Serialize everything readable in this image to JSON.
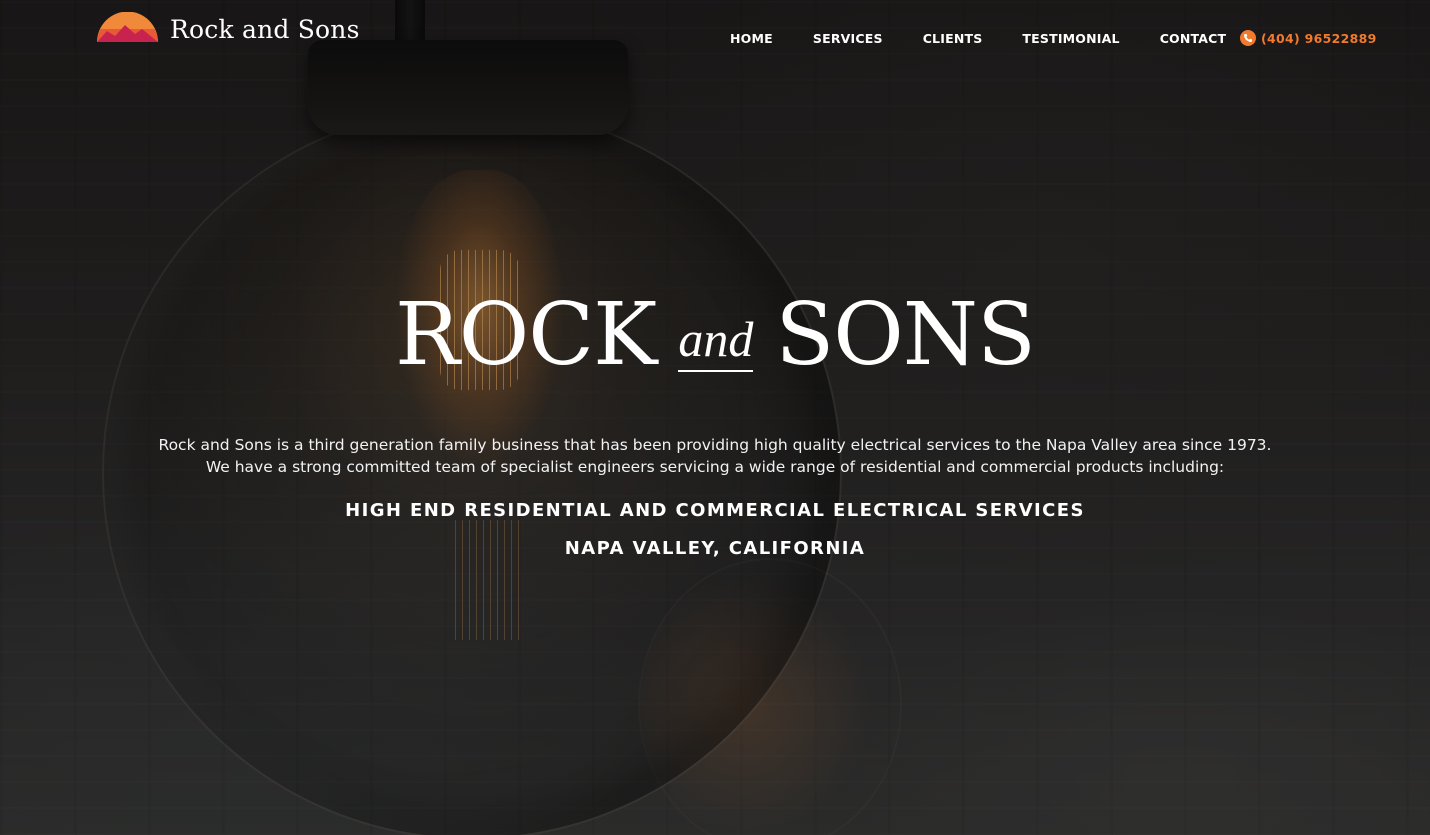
{
  "brand": {
    "name": "Rock and Sons",
    "logo_colors": [
      "#f08a3a",
      "#e2463f",
      "#c8234f"
    ]
  },
  "nav": {
    "items": [
      {
        "label": "HOME"
      },
      {
        "label": "SERVICES"
      },
      {
        "label": "CLIENTS"
      },
      {
        "label": "TESTIMONIAL"
      },
      {
        "label": "CONTACT"
      }
    ],
    "phone": {
      "icon": "phone-icon",
      "number": "(404) 96522889",
      "color": "#f07a2e"
    }
  },
  "hero": {
    "title_left": "ROCK",
    "title_connector": "and",
    "title_right": "SONS",
    "description": [
      "Rock and Sons is a third generation family business that has been providing high quality electrical services to the Napa Valley area since 1973.",
      "We have a strong committed team of specialist engineers servicing a wide range of residential and commercial products including:"
    ],
    "tagline": "HIGH END RESIDENTIAL AND COMMERCIAL ELECTRICAL SERVICES",
    "location": "NAPA VALLEY, CALIFORNIA"
  }
}
